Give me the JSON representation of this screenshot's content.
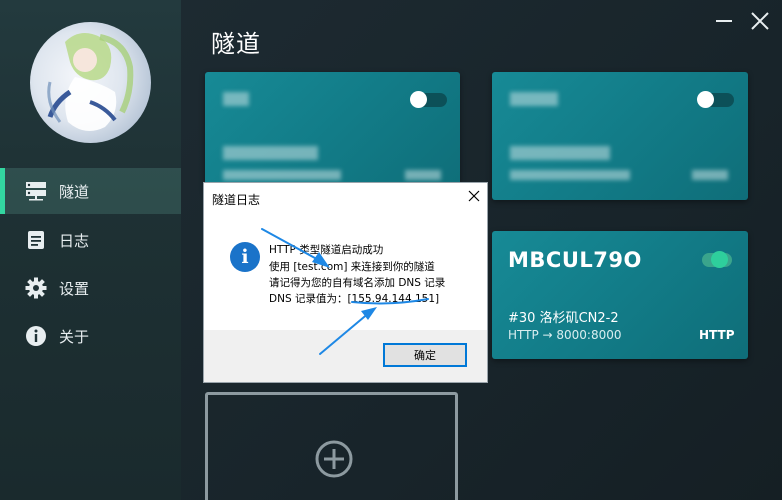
{
  "sidebar": {
    "items": [
      {
        "label": "隧道",
        "icon": "server-icon",
        "active": true
      },
      {
        "label": "日志",
        "icon": "log-icon",
        "active": false
      },
      {
        "label": "设置",
        "icon": "gear-icon",
        "active": false
      },
      {
        "label": "关于",
        "icon": "info-icon",
        "active": false
      }
    ]
  },
  "main": {
    "title": "隧道"
  },
  "cards": [
    {
      "state": "blurred",
      "enabled": false
    },
    {
      "state": "blurred",
      "enabled": false
    },
    {
      "name": "MBCUL79O",
      "node": "#30 洛杉矶CN2-2",
      "route": "HTTP → 8000:8000",
      "protocol": "HTTP",
      "enabled": true
    }
  ],
  "dialog": {
    "title": "隧道日志",
    "lines": [
      "HTTP 类型隧道启动成功",
      "使用 [test.com] 来连接到你的隧道",
      "请记得为您的自有域名添加 DNS 记录",
      "DNS 记录值为：[155.94.144.151]"
    ],
    "ok_label": "确定"
  },
  "colors": {
    "accent": "#33d6a0",
    "card": "#127c88",
    "arrow": "#1e88e5"
  }
}
